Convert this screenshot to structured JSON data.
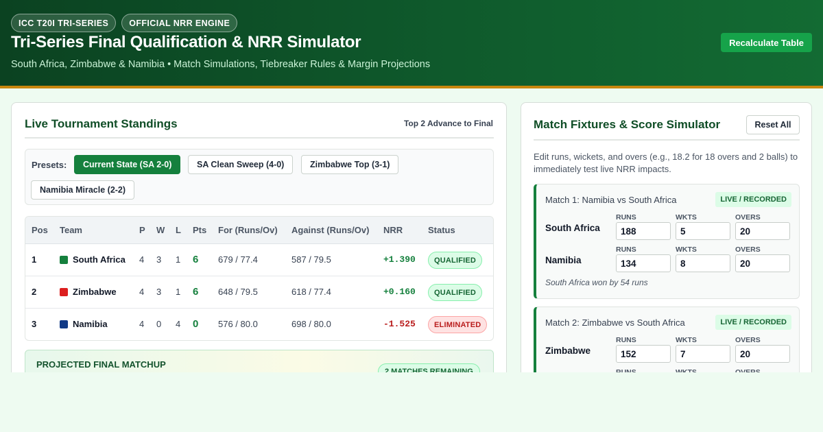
{
  "header": {
    "badges": [
      "ICC T20I TRI-SERIES",
      "OFFICIAL NRR ENGINE"
    ],
    "title": "Tri-Series Final Qualification & NRR Simulator",
    "subtitle": "South Africa, Zimbabwe & Namibia • Match Simulations, Tiebreaker Rules & Margin Projections",
    "recalc_label": "Recalculate Table"
  },
  "standings_panel": {
    "title": "Live Tournament Standings",
    "note": "Top 2 Advance to Final",
    "presets_label": "Presets:",
    "presets": [
      {
        "label": "Current State (SA 2-0)",
        "active": true
      },
      {
        "label": "SA Clean Sweep (4-0)",
        "active": false
      },
      {
        "label": "Zimbabwe Top (3-1)",
        "active": false
      },
      {
        "label": "Namibia Miracle (2-2)",
        "active": false
      }
    ],
    "columns": [
      "Pos",
      "Team",
      "P",
      "W",
      "L",
      "Pts",
      "For (Runs/Ov)",
      "Against (Runs/Ov)",
      "NRR",
      "Status"
    ],
    "rows": [
      {
        "pos": "1",
        "team": "South Africa",
        "color": "#15803d",
        "p": "4",
        "w": "3",
        "l": "1",
        "pts": "6",
        "for": "679 / 77.4",
        "against": "587 / 79.5",
        "nrr": "+1.390",
        "status": "QUALIFIED"
      },
      {
        "pos": "2",
        "team": "Zimbabwe",
        "color": "#dc1f1f",
        "p": "4",
        "w": "3",
        "l": "1",
        "pts": "6",
        "for": "648 / 79.5",
        "against": "618 / 77.4",
        "nrr": "+0.160",
        "status": "QUALIFIED"
      },
      {
        "pos": "3",
        "team": "Namibia",
        "color": "#113a86",
        "p": "4",
        "w": "0",
        "l": "4",
        "pts": "0",
        "for": "576 / 80.0",
        "against": "698 / 80.0",
        "nrr": "-1.525",
        "status": "ELIMINATED"
      }
    ],
    "projected": {
      "title": "PROJECTED FINAL MATCHUP",
      "badge": "2 MATCHES REMAINING"
    }
  },
  "fixtures_panel": {
    "title": "Match Fixtures & Score Simulator",
    "reset_label": "Reset All",
    "description": "Edit runs, wickets, and overs (e.g., 18.2 for 18 overs and 2 balls) to immediately test live NRR impacts.",
    "field_labels": {
      "runs": "RUNS",
      "wkts": "WKTS",
      "overs": "OVERS"
    },
    "matches": [
      {
        "title": "Match 1: Namibia vs South Africa",
        "badge": "LIVE / RECORDED",
        "teams": [
          {
            "name": "South Africa",
            "runs": "188",
            "wkts": "5",
            "overs": "20"
          },
          {
            "name": "Namibia",
            "runs": "134",
            "wkts": "8",
            "overs": "20"
          }
        ],
        "result": "South Africa won by 54 runs"
      },
      {
        "title": "Match 2: Zimbabwe vs South Africa",
        "badge": "LIVE / RECORDED",
        "teams": [
          {
            "name": "Zimbabwe",
            "runs": "152",
            "wkts": "7",
            "overs": "20"
          }
        ]
      }
    ]
  },
  "colors": {
    "header_bg": "#0f5a2c",
    "accent_bar": "#c8860e",
    "primary_button": "#16a34a",
    "positive_nrr": "#15803d",
    "negative_nrr": "#b91c1c"
  }
}
